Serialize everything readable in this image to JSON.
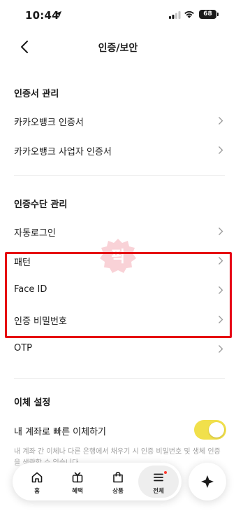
{
  "status": {
    "time": "10:44",
    "battery": "68"
  },
  "header": {
    "title": "인증/보안"
  },
  "cert_section": {
    "title": "인증서 관리",
    "items": [
      {
        "label": "카카오뱅크 인증서"
      },
      {
        "label": "카카오뱅크 사업자 인증서"
      }
    ]
  },
  "auth_section": {
    "title": "인증수단 관리",
    "items": [
      {
        "label": "자동로그인"
      },
      {
        "label": "패턴"
      },
      {
        "label": "Face ID"
      },
      {
        "label": "인증 비밀번호"
      },
      {
        "label": "OTP"
      }
    ]
  },
  "transfer_section": {
    "title": "이체 설정",
    "quick_transfer_label": "내 계좌로 빠른 이체하기",
    "quick_transfer_on": true,
    "description": "내 계좌 간 이체나 다른 은행에서 채우기 시 인증 비밀번호 및 생체 인증을 생략할 수 있습니다."
  },
  "watermark_text": "픽",
  "bottom_nav": {
    "items": [
      {
        "label": "홈",
        "icon": "home-icon"
      },
      {
        "label": "혜택",
        "icon": "gift-icon"
      },
      {
        "label": "상품",
        "icon": "bag-icon"
      },
      {
        "label": "전체",
        "icon": "menu-icon",
        "active": true
      }
    ]
  },
  "colors": {
    "accent": "#f1e04b",
    "highlight": "#e60012",
    "badge": "#ff3b30"
  }
}
